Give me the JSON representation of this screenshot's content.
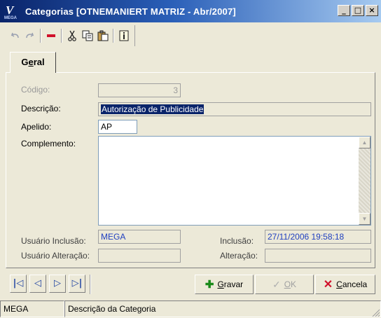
{
  "window": {
    "title": "Categorias [OTNEMANIERT MATRIZ - Abr/2007]",
    "minimize": "_",
    "maximize": "□",
    "close": "×"
  },
  "toolbar": {
    "icons": [
      "undo-icon",
      "redo-icon",
      "delete-icon",
      "cut-icon",
      "copy-icon",
      "paste-icon",
      "info-icon"
    ]
  },
  "tabs": [
    {
      "label_pre": "G",
      "label_ul": "e",
      "label_post": "ral",
      "active": true
    }
  ],
  "form": {
    "codigo_label": "Código:",
    "codigo_value": "3",
    "descricao_label": "Descrição:",
    "descricao_value": "Autorização de Publicidade",
    "apelido_label": "Apelido:",
    "apelido_value": "AP",
    "complemento_label": "Complemento:",
    "complemento_value": "",
    "usuario_inclusao_label": "Usuário Inclusão:",
    "usuario_inclusao_value": "MEGA",
    "inclusao_label": "Inclusão:",
    "inclusao_value": "27/11/2006 19:58:18",
    "usuario_alteracao_label": "Usuário Alteração:",
    "usuario_alteracao_value": "",
    "alteracao_label": "Alteração:",
    "alteracao_value": ""
  },
  "navigation": {
    "first": "|◁",
    "prev": "◁",
    "next": "▷",
    "last": "▷|"
  },
  "actions": {
    "gravar_ul": "G",
    "gravar_rest": "ravar",
    "ok_ul": "O",
    "ok_rest": "K",
    "cancela_ul": "C",
    "cancela_rest": "ancela"
  },
  "status": {
    "user": "MEGA",
    "description": "Descrição da Categoria"
  }
}
